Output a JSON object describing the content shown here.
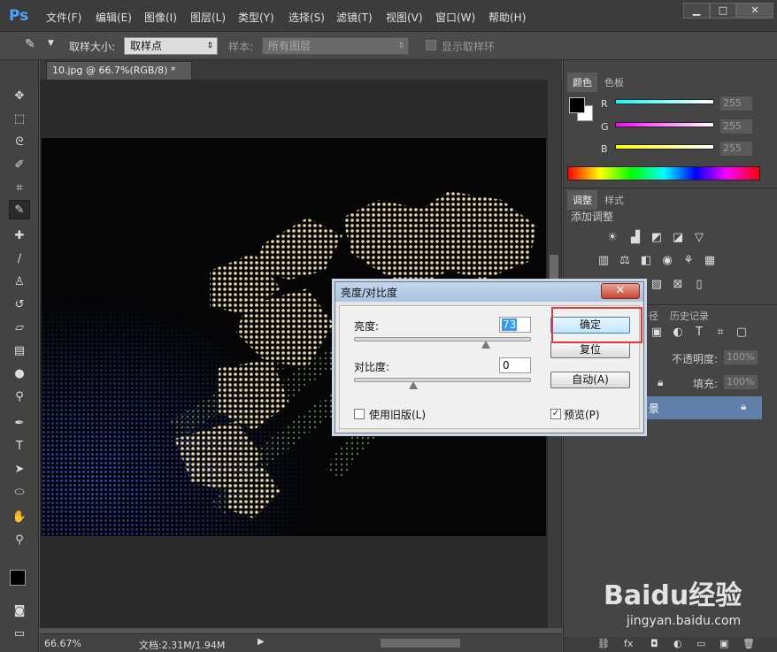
{
  "app": {
    "logo": "Ps"
  },
  "menu": [
    "文件(F)",
    "编辑(E)",
    "图像(I)",
    "图层(L)",
    "类型(Y)",
    "选择(S)",
    "滤镜(T)",
    "视图(V)",
    "窗口(W)",
    "帮助(H)"
  ],
  "window_controls": {
    "minimize": "▁",
    "maximize": "□",
    "close": "✕"
  },
  "options": {
    "sample_size_label": "取样大小:",
    "sample_size_value": "取样点",
    "sample_label": "样本:",
    "sample_value": "所有图层",
    "show_ring_label": "显示取样环"
  },
  "document": {
    "tab_title": "10.jpg @ 66.7%(RGB/8) *",
    "tab_close": "×"
  },
  "status": {
    "zoom": "66.67%",
    "doc_info": "文档:2.31M/1.94M"
  },
  "color_panel": {
    "tabs": [
      "颜色",
      "色板"
    ],
    "channels": [
      {
        "name": "R",
        "value": "255"
      },
      {
        "name": "G",
        "value": "255"
      },
      {
        "name": "B",
        "value": "255"
      }
    ]
  },
  "adjust_panel": {
    "tabs": [
      "调整",
      "样式"
    ],
    "title": "添加调整"
  },
  "layers_panel": {
    "tabs": [
      "径",
      "历史记录"
    ],
    "opacity_label": "不透明度:",
    "opacity_value": "100%",
    "fill_label": "填充:",
    "fill_value": "100%",
    "layer_name_fragment": "景"
  },
  "dialog": {
    "title": "亮度/对比度",
    "brightness_label": "亮度:",
    "brightness_value": "73",
    "brightness_level": 73,
    "contrast_label": "对比度:",
    "contrast_value": "0",
    "contrast_level": 0,
    "legacy_label": "使用旧版(L)",
    "legacy_checked": false,
    "preview_label": "预览(P)",
    "preview_checked": true,
    "ok_label": "确定",
    "reset_label": "复位",
    "auto_label": "自动(A)"
  },
  "watermark": {
    "text": "Baidu经验",
    "url": "jingyan.baidu.com"
  },
  "colors": {
    "highlight_box": "#e53935",
    "accent": "#4da3ff"
  }
}
